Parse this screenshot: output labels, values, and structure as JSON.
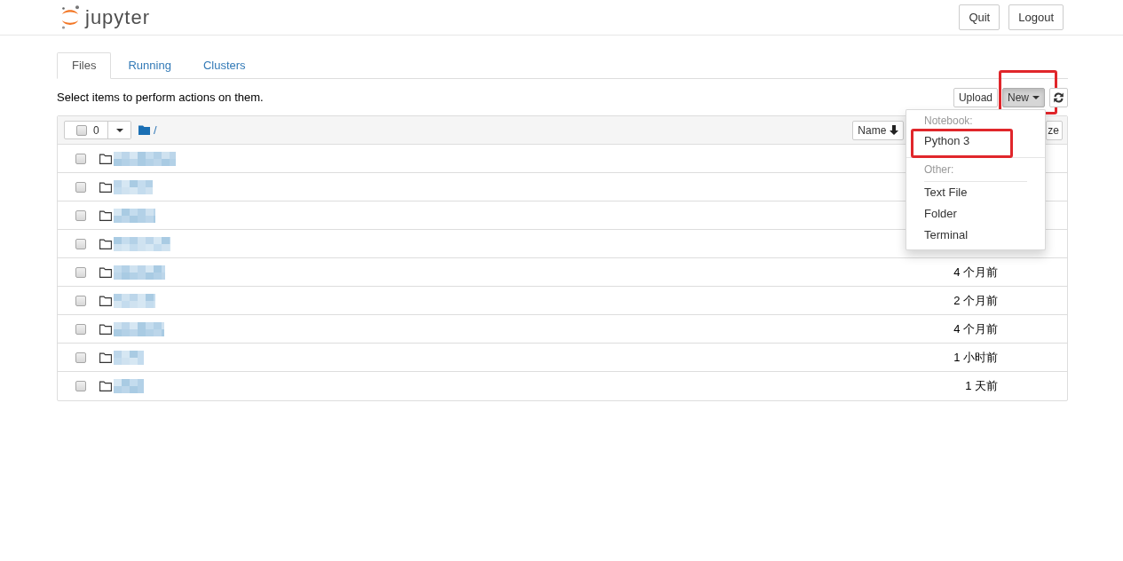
{
  "header": {
    "logo_text": "jupyter",
    "buttons": [
      {
        "label": "Quit"
      },
      {
        "label": "Logout"
      }
    ]
  },
  "tabs": [
    {
      "label": "Files",
      "selected": true
    },
    {
      "label": "Running",
      "selected": false
    },
    {
      "label": "Clusters",
      "selected": false
    }
  ],
  "hint": "Select items to perform actions on them.",
  "toolbar": [
    {
      "kind": "upload",
      "label": "Upload",
      "active": false,
      "highlighted": false
    },
    {
      "kind": "new",
      "label": "New",
      "active": true,
      "highlighted": true
    },
    {
      "kind": "refresh",
      "active": false,
      "highlighted": false
    }
  ],
  "listing": {
    "select_all": {
      "checked": false,
      "count": "0"
    },
    "path": "/",
    "sort_buttons": [
      {
        "label": "Name",
        "sorted": true
      },
      {
        "label": "ze",
        "sorted": false
      }
    ],
    "rows": [
      {
        "kind": "folder",
        "checked": false
      },
      {
        "kind": "folder",
        "checked": false
      },
      {
        "kind": "folder",
        "checked": false
      },
      {
        "kind": "folder",
        "checked": false
      },
      {
        "kind": "folder",
        "checked": false,
        "modified": "4 个月前"
      },
      {
        "kind": "folder",
        "checked": false,
        "modified": "2 个月前"
      },
      {
        "kind": "folder",
        "checked": false,
        "modified": "4 个月前"
      },
      {
        "kind": "folder",
        "checked": false,
        "modified": "1 小时前"
      },
      {
        "kind": "folder",
        "checked": false,
        "modified": "1 天前"
      }
    ]
  },
  "new_menu": {
    "open": true,
    "sections": [
      {
        "header": "Notebook:",
        "items": [
          {
            "label": "Python 3",
            "highlighted": true
          }
        ]
      },
      {
        "header": "Other:",
        "items": [
          {
            "label": "Text File",
            "highlighted": false
          },
          {
            "label": "Folder",
            "highlighted": false
          },
          {
            "label": "Terminal",
            "highlighted": false
          }
        ]
      }
    ]
  }
}
